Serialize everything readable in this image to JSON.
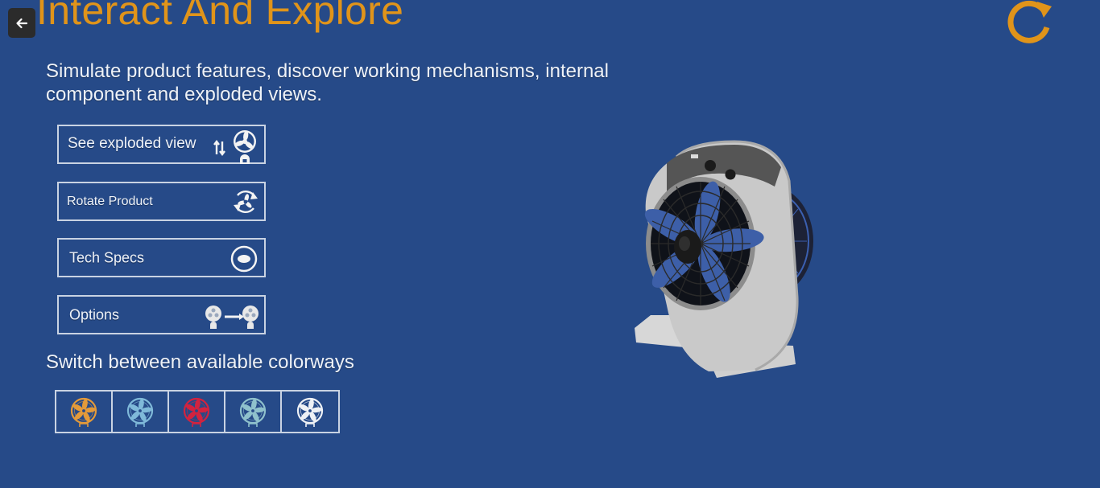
{
  "header": {
    "title": "Interact And Explore",
    "back_icon": "arrow-left-icon",
    "reset_icon": "refresh-icon"
  },
  "intro": {
    "text": "Simulate product features, discover working mechanisms, internal component and exploded views."
  },
  "actions": [
    {
      "label": "See exploded view",
      "icon": "exploded-view-icon"
    },
    {
      "label": "Rotate Product",
      "icon": "rotate-product-icon"
    },
    {
      "label": "Tech Specs",
      "icon": "tech-specs-icon"
    },
    {
      "label": "Options",
      "icon": "options-icon"
    }
  ],
  "colorways": {
    "heading": "Switch between available colorways",
    "swatches": [
      {
        "name": "orange",
        "color": "#e39a3a"
      },
      {
        "name": "light-blue",
        "color": "#7fb9d9"
      },
      {
        "name": "red",
        "color": "#d2233f"
      },
      {
        "name": "teal",
        "color": "#8fc1cc"
      },
      {
        "name": "white",
        "color": "#eef1f5"
      }
    ]
  },
  "colors": {
    "background": "#264a88",
    "accent": "#e0941a",
    "border": "#c9d3e3"
  },
  "product": {
    "type": "box-fan",
    "body_color": "#cfcfcf",
    "top_color": "#5a5a5a",
    "blade_color": "#3d5fa8"
  }
}
